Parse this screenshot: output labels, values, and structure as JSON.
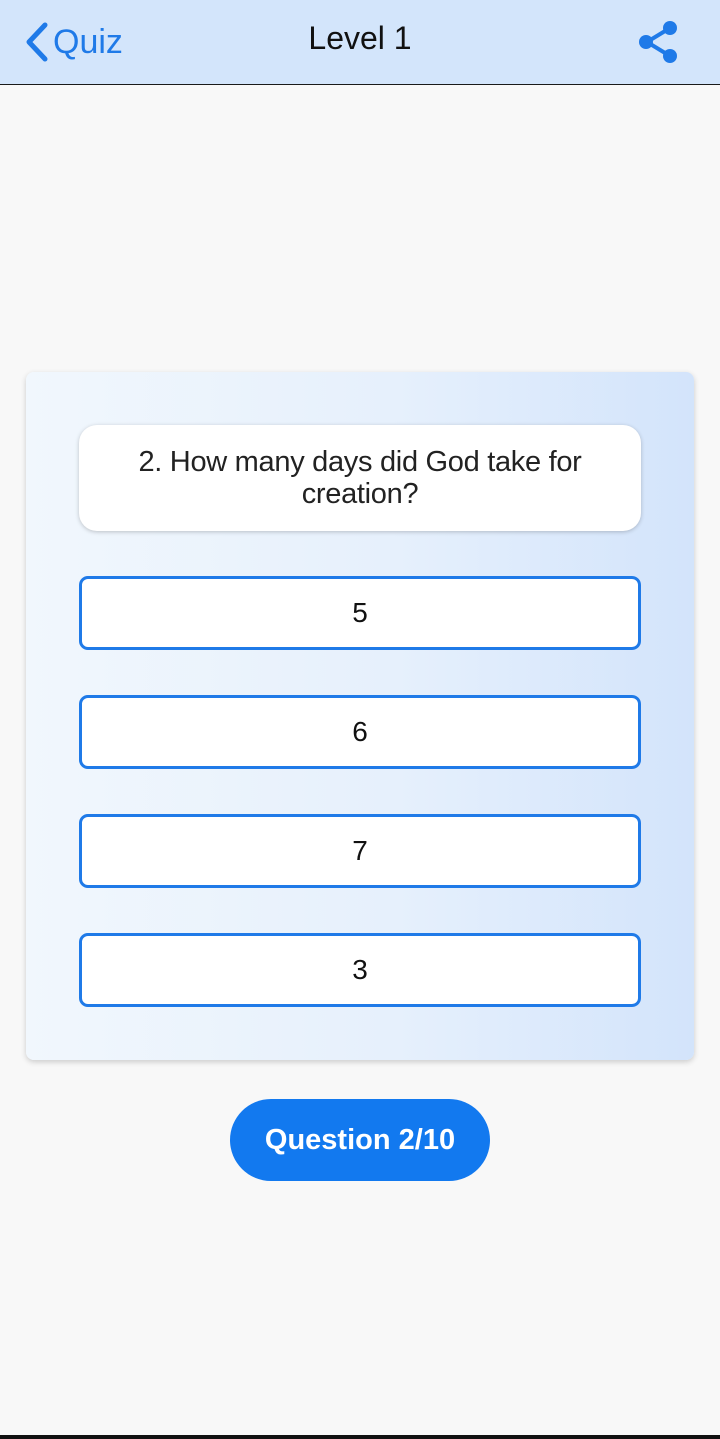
{
  "navbar": {
    "back_label": "Quiz",
    "title": "Level 1",
    "back_icon": "chevron-left-icon",
    "share_icon": "share-icon",
    "accent_color": "#1f7ae8",
    "background_color": "#d3e5fb"
  },
  "quiz": {
    "question": "2. How many days did God take for creation?",
    "options": [
      {
        "label": "5"
      },
      {
        "label": "6"
      },
      {
        "label": "7"
      },
      {
        "label": "3"
      }
    ],
    "progress_label": "Question 2/10",
    "progress_fraction": 0.2
  },
  "colors": {
    "option_border": "#1f7ae8",
    "progress_pill": "#1279ef",
    "page_background": "#f8f8f8"
  }
}
